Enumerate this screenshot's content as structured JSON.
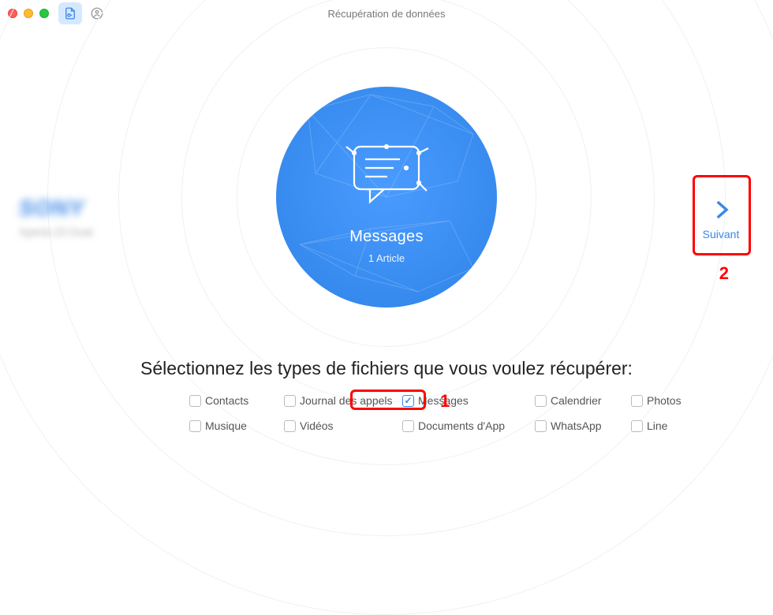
{
  "window": {
    "title": "Récupération de données"
  },
  "device": {
    "brand": "SONY",
    "model": "Xperia Z3 Dual"
  },
  "center": {
    "title": "Messages",
    "subtitle": "1 Article"
  },
  "next": {
    "label": "Suivant"
  },
  "instruction": "Sélectionnez les types de fichiers que vous voulez récupérer:",
  "options": {
    "row1": [
      {
        "label": "Contacts",
        "checked": false
      },
      {
        "label": "Journal des appels",
        "checked": false
      },
      {
        "label": "Messages",
        "checked": true
      },
      {
        "label": "Calendrier",
        "checked": false
      },
      {
        "label": "Photos",
        "checked": false
      }
    ],
    "row2": [
      {
        "label": "Musique",
        "checked": false
      },
      {
        "label": "Vidéos",
        "checked": false
      },
      {
        "label": "Documents d'App",
        "checked": false
      },
      {
        "label": "WhatsApp",
        "checked": false
      },
      {
        "label": "Line",
        "checked": false
      }
    ]
  },
  "annotations": {
    "num1": "1",
    "num2": "2"
  }
}
